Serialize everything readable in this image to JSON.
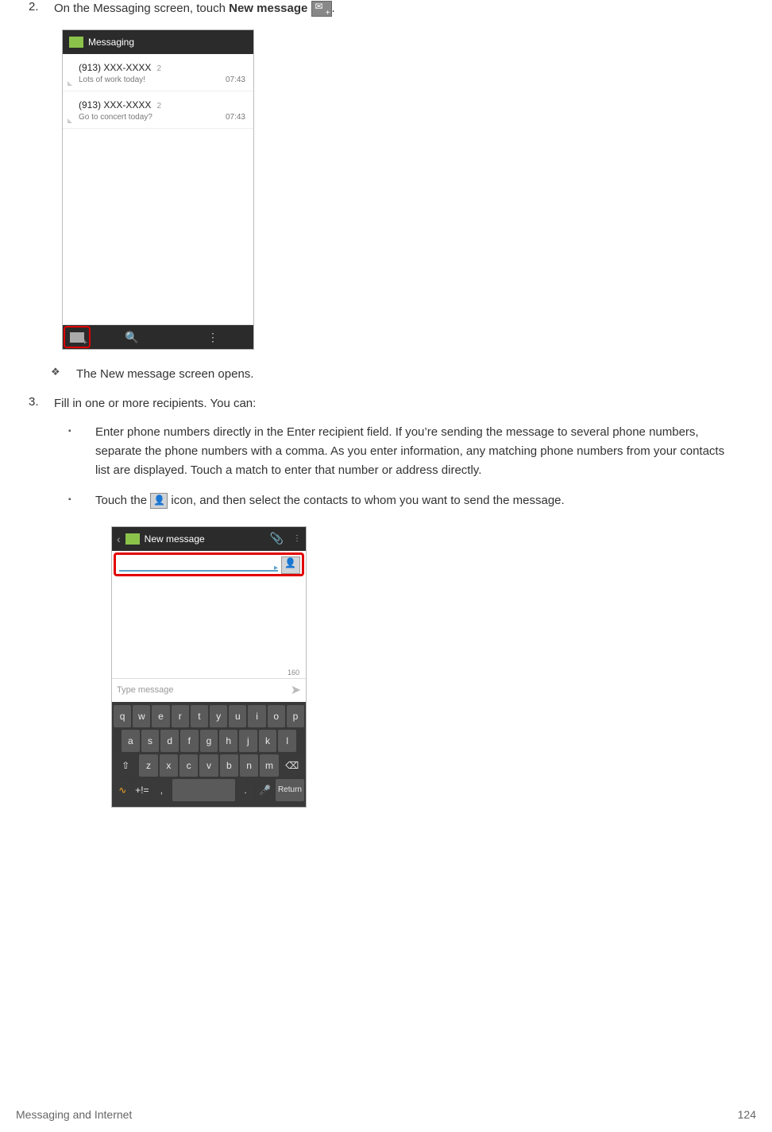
{
  "step2": {
    "num": "2.",
    "text_pre": "On the Messaging screen, touch ",
    "bold": "New message",
    "text_post": "."
  },
  "screenshot1": {
    "title": "Messaging",
    "threads": [
      {
        "number": "(913) XXX-XXXX",
        "count": "2",
        "preview": "Lots of work today!",
        "time": "07:43"
      },
      {
        "number": "(913) XXX-XXXX",
        "count": "2",
        "preview": "Go to concert today?",
        "time": "07:43"
      }
    ]
  },
  "bullet_result": "The New message screen opens.",
  "step3": {
    "num": "3.",
    "text": "Fill in one or more recipients. You can:"
  },
  "sub1": "Enter phone numbers directly in the Enter recipient field. If you’re sending the message to several phone numbers, separate the phone numbers with a comma. As you enter information, any matching phone numbers from your contacts list are displayed. Touch a match to enter that number or address directly.",
  "sub2_pre": "Touch the ",
  "sub2_post": " icon, and then select the contacts to whom you want to send the message.",
  "screenshot2": {
    "title": "New message",
    "count": "160",
    "placeholder": "Type message",
    "keys_r1": [
      "q",
      "w",
      "e",
      "r",
      "t",
      "y",
      "u",
      "i",
      "o",
      "p"
    ],
    "keys_r2": [
      "a",
      "s",
      "d",
      "f",
      "g",
      "h",
      "j",
      "k",
      "l"
    ],
    "keys_r3": [
      "z",
      "x",
      "c",
      "v",
      "b",
      "n",
      "m"
    ],
    "shift": "⇧",
    "bksp": "⌫",
    "sym": "+!=",
    "voice": "🎤",
    "ret": "Return"
  },
  "footer": {
    "section": "Messaging and Internet",
    "page": "124"
  }
}
